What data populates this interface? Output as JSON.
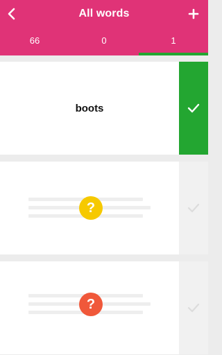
{
  "colors": {
    "accent": "#e03377",
    "green": "#23a631",
    "indicator": "#23a631",
    "yellow": "#f6c900",
    "orange": "#f0583a"
  },
  "header": {
    "title": "All words",
    "back_icon": "chevron-left-icon",
    "add_icon": "plus-icon"
  },
  "tabs": [
    {
      "label": "66",
      "active": false
    },
    {
      "label": "0",
      "active": false
    },
    {
      "label": "1",
      "active": true
    }
  ],
  "cards": [
    {
      "word": "boots",
      "status": "known",
      "check_icon": "check-icon"
    },
    {
      "status": "unknown",
      "badge_icon": "question-icon",
      "badge_text": "?",
      "badge_color": "#f6c900"
    },
    {
      "status": "unknown",
      "badge_icon": "question-icon",
      "badge_text": "?",
      "badge_color": "#f0583a"
    }
  ]
}
